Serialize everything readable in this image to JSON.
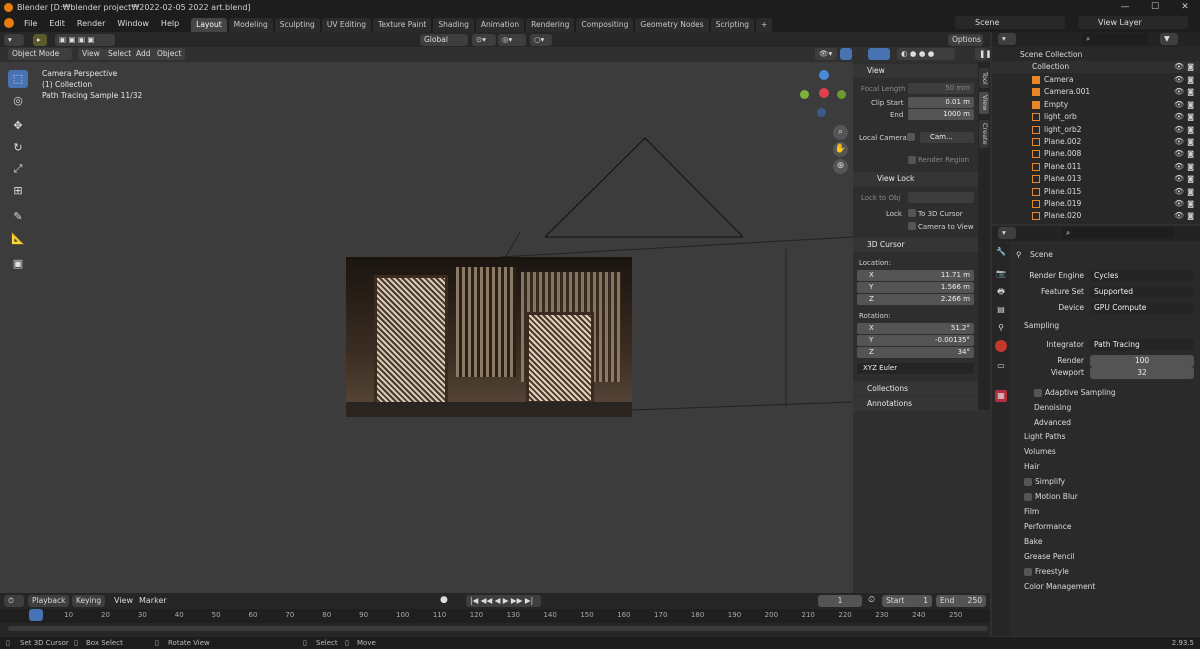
{
  "window": {
    "title": "Blender [D:₩blender project₩2022-02-05 2022 art.blend]",
    "min": "—",
    "max": "☐",
    "close": "✕"
  },
  "menu": [
    "File",
    "Edit",
    "Render",
    "Window",
    "Help"
  ],
  "workspaces": [
    "Layout",
    "Modeling",
    "Sculpting",
    "UV Editing",
    "Texture Paint",
    "Shading",
    "Animation",
    "Rendering",
    "Compositing",
    "Geometry Nodes",
    "Scripting",
    "+"
  ],
  "active_workspace": "Layout",
  "scene_name": "Scene",
  "view_layer": "View Layer",
  "header": {
    "transform_orientation": "Global",
    "options": "Options"
  },
  "header2": {
    "mode": "Object Mode",
    "menus": [
      "View",
      "Select",
      "Add",
      "Object"
    ]
  },
  "viewport": {
    "line1": "Camera Perspective",
    "line2": "(1) Collection",
    "line3": "Path Tracing Sample 11/32"
  },
  "npanel": {
    "tabs": [
      "Tool",
      "View",
      "Create"
    ],
    "view_title": "View",
    "focal_length_label": "Focal Length",
    "focal_length": "50 mm",
    "clip_start_label": "Clip Start",
    "clip_start": "0.01 m",
    "end_label": "End",
    "end": "1000 m",
    "local_camera_label": "Local Camera",
    "local_camera": "Cam...",
    "render_region": "Render Region",
    "view_lock_title": "View Lock",
    "lock_to_obj_label": "Lock to Obj",
    "lock_label": "Lock",
    "to_3d_cursor": "To 3D Cursor",
    "camera_to_view": "Camera to View",
    "cursor_title": "3D Cursor",
    "location_label": "Location:",
    "loc_x_label": "X",
    "loc_x": "11.71 m",
    "loc_y_label": "Y",
    "loc_y": "1.566 m",
    "loc_z_label": "Z",
    "loc_z": "2.266 m",
    "rotation_label": "Rotation:",
    "rot_x_label": "X",
    "rot_x": "51.2°",
    "rot_y_label": "Y",
    "rot_y": "-0.00135°",
    "rot_z_label": "Z",
    "rot_z": "34°",
    "rot_mode": "XYZ Euler",
    "collections": "Collections",
    "annotations": "Annotations"
  },
  "outliner": {
    "root": "Scene Collection",
    "collection": "Collection",
    "items": [
      "Camera",
      "Camera.001",
      "Empty",
      "light_orb",
      "light_orb2",
      "Plane.002",
      "Plane.008",
      "Plane.011",
      "Plane.013",
      "Plane.015",
      "Plane.019",
      "Plane.020"
    ]
  },
  "properties": {
    "scene": "Scene",
    "render_engine_label": "Render Engine",
    "render_engine": "Cycles",
    "feature_set_label": "Feature Set",
    "feature_set": "Supported",
    "device_label": "Device",
    "device": "GPU Compute",
    "sampling": "Sampling",
    "integrator_label": "Integrator",
    "integrator": "Path Tracing",
    "render_label": "Render",
    "render_samples": "100",
    "viewport_label": "Viewport",
    "viewport_samples": "32",
    "subsections": [
      "Adaptive Sampling",
      "Denoising",
      "Advanced"
    ],
    "sections": [
      "Light Paths",
      "Volumes",
      "Hair",
      "Simplify",
      "Motion Blur",
      "Film",
      "Performance",
      "Bake",
      "Grease Pencil",
      "Freestyle",
      "Color Management"
    ]
  },
  "timeline": {
    "menus": [
      "Playback",
      "Keying",
      "View",
      "Marker"
    ],
    "current_frame": "1",
    "start_label": "Start",
    "start": "1",
    "end_label": "End",
    "end": "250",
    "ticks": [
      "1",
      "10",
      "20",
      "30",
      "40",
      "50",
      "60",
      "70",
      "80",
      "90",
      "100",
      "110",
      "120",
      "130",
      "140",
      "150",
      "160",
      "170",
      "180",
      "190",
      "200",
      "210",
      "220",
      "230",
      "240",
      "250"
    ]
  },
  "status": {
    "set_cursor": "Set 3D Cursor",
    "box_select": "Box Select",
    "rotate_view": "Rotate View",
    "select": "Select",
    "move": "Move",
    "version": "2.93.5"
  }
}
